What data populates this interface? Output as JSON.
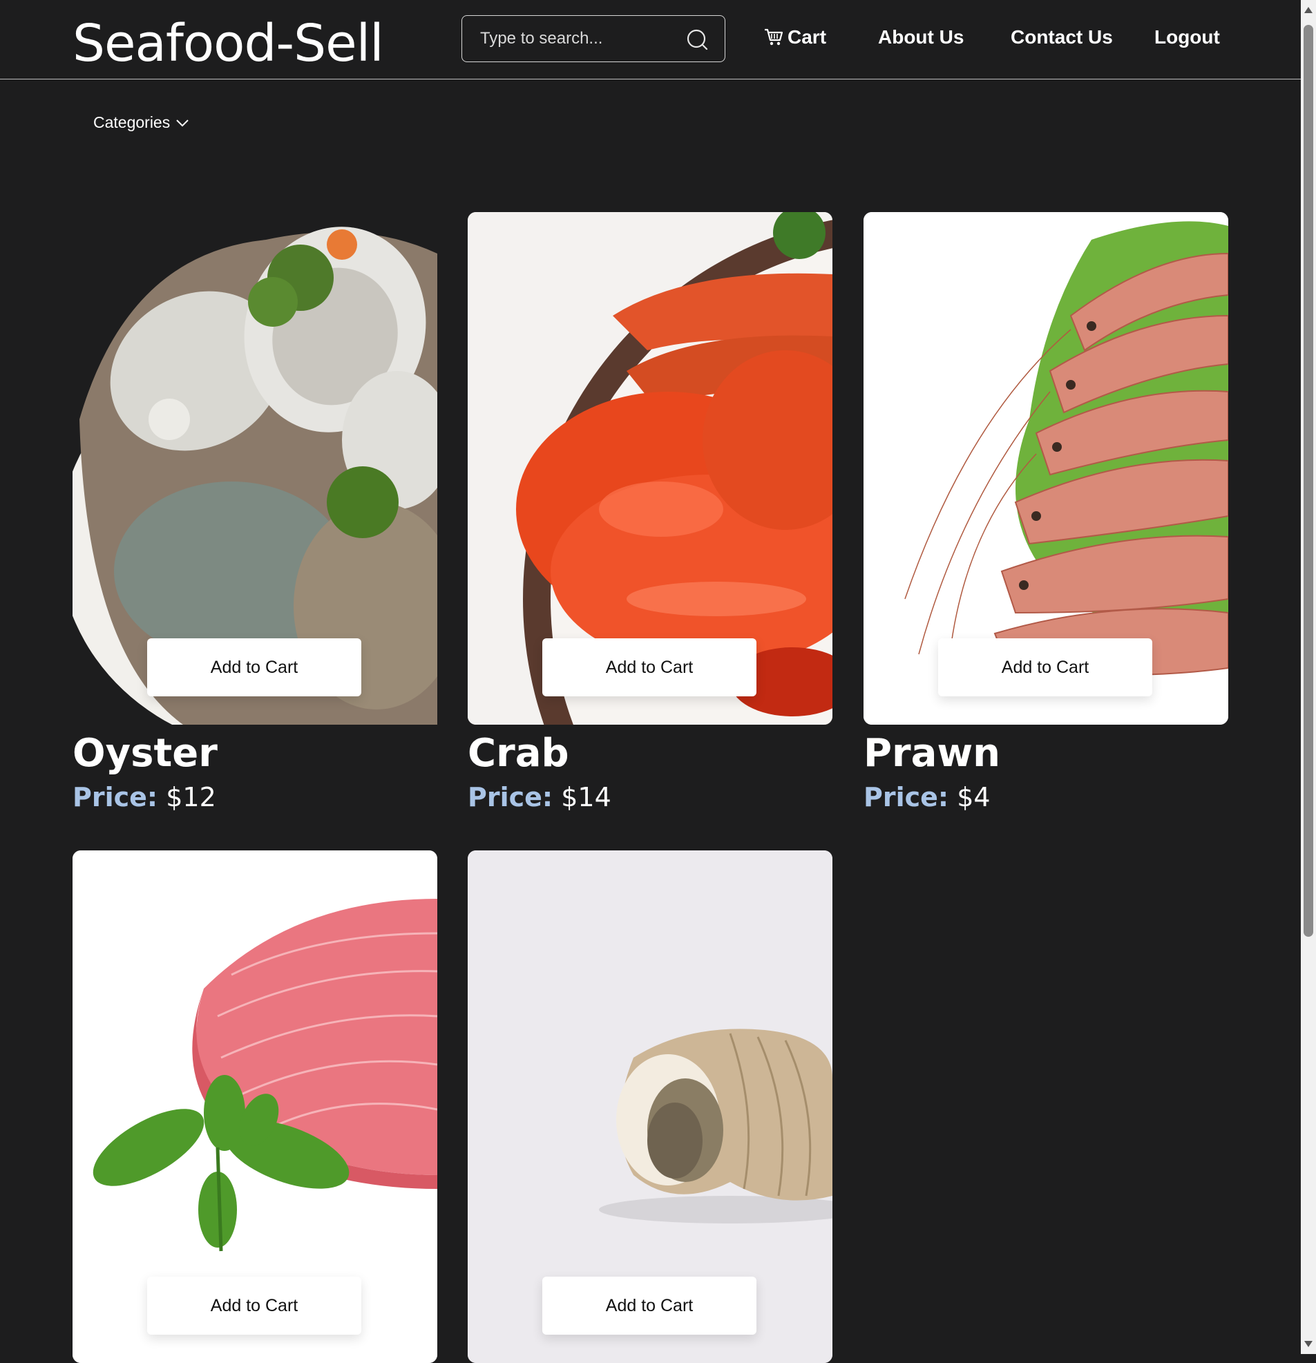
{
  "header": {
    "brand": "Seafood-Sell",
    "search": {
      "placeholder": "Type to search..."
    },
    "nav": {
      "cart": "Cart",
      "about": "About Us",
      "contact": "Contact Us",
      "logout": "Logout"
    }
  },
  "categories": {
    "label": "Categories"
  },
  "products": [
    {
      "name": "Oyster",
      "price_label": "Price:",
      "price": "$12",
      "button": "Add to Cart"
    },
    {
      "name": "Crab",
      "price_label": "Price:",
      "price": "$14",
      "button": "Add to Cart"
    },
    {
      "name": "Prawn",
      "price_label": "Price:",
      "price": "$4",
      "button": "Add to Cart"
    },
    {
      "name": "",
      "price_label": "",
      "price": "",
      "button": "Add to Cart"
    },
    {
      "name": "",
      "price_label": "",
      "price": "",
      "button": "Add to Cart"
    }
  ],
  "colors": {
    "background": "#1d1d1e",
    "price_label": "#a9c4e6",
    "button_bg": "#ffffff"
  }
}
